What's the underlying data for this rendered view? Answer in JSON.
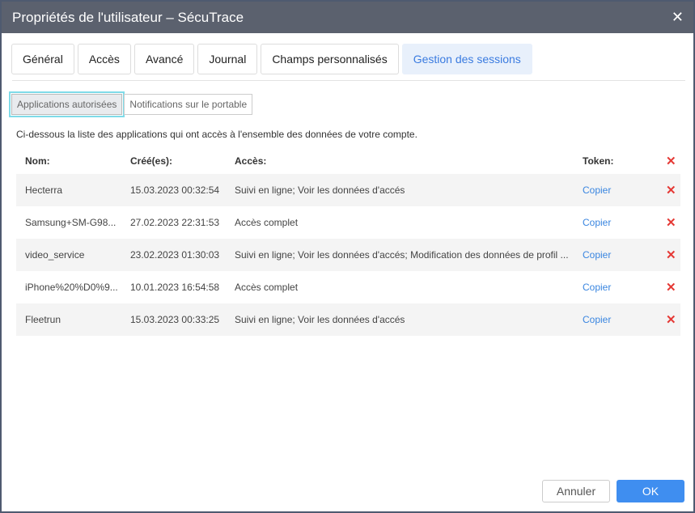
{
  "title": "Propriétés de l'utilisateur – SécuTrace",
  "tabs": [
    "Général",
    "Accès",
    "Avancé",
    "Journal",
    "Champs personnalisés",
    "Gestion des sessions"
  ],
  "subtabs": [
    "Applications autorisées",
    "Notifications sur le portable"
  ],
  "description": "Ci-dessous la liste des applications qui ont accès à l'ensemble des données de votre compte.",
  "headers": {
    "name": "Nom:",
    "created": "Créé(es):",
    "access": "Accès:",
    "token": "Token:"
  },
  "rows": [
    {
      "name": "Hecterra",
      "created": "15.03.2023 00:32:54",
      "access": "Suivi en ligne; Voir les données d'accés",
      "token": "Copier"
    },
    {
      "name": "Samsung+SM-G98...",
      "created": "27.02.2023 22:31:53",
      "access": "Accès complet",
      "token": "Copier"
    },
    {
      "name": "video_service",
      "created": "23.02.2023 01:30:03",
      "access": "Suivi en ligne; Voir les données d'accés; Modification des données de profil ...",
      "token": "Copier"
    },
    {
      "name": "iPhone%20%D0%9...",
      "created": "10.01.2023 16:54:58",
      "access": "Accès complet",
      "token": "Copier"
    },
    {
      "name": "Fleetrun",
      "created": "15.03.2023 00:33:25",
      "access": "Suivi en ligne; Voir les données d'accés",
      "token": "Copier"
    }
  ],
  "icons": {
    "delete": "✕",
    "close": "✕"
  },
  "buttons": {
    "cancel": "Annuler",
    "ok": "OK"
  }
}
